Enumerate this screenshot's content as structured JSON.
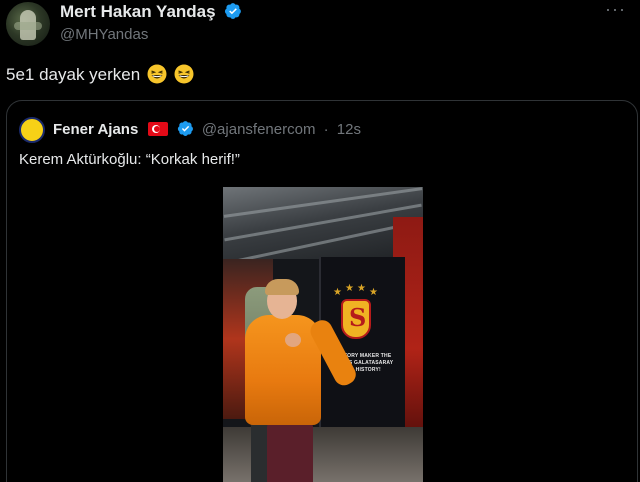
{
  "tweet": {
    "display_name": "Mert Hakan Yandaş",
    "handle": "@MHYandas",
    "text": "5e1 dayak yerken",
    "emoji_icons": [
      "grinning-squinting-face-icon",
      "grinning-squinting-face-icon"
    ],
    "verified_icon": "verified-badge-icon",
    "more_icon": "more-options-icon"
  },
  "quote": {
    "display_name": "Fener Ajans",
    "flag_icon": "turkey-flag-icon",
    "verified_icon": "verified-badge-icon",
    "handle": "@ajansfenercom",
    "separator": "·",
    "time": "12s",
    "text": "Kerem Aktürkoğlu: “Korkak herif!”",
    "media": {
      "banner_text": "HISTORY MAKER THE FACTS GALATASARAY MAKES HISTORY!"
    }
  },
  "colors": {
    "background": "#000000",
    "text_primary": "#e7e9ea",
    "text_secondary": "#71767b",
    "border": "#2f3336",
    "verified_blue": "#1d9bf0"
  }
}
